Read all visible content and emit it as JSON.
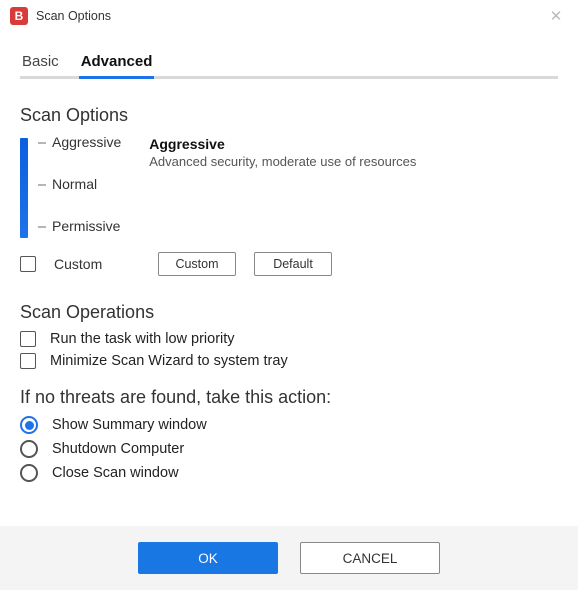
{
  "window": {
    "title": "Scan Options",
    "app_icon_letter": "B"
  },
  "tabs": {
    "basic": "Basic",
    "advanced": "Advanced",
    "active": "advanced"
  },
  "sections": {
    "scan_options_heading": "Scan Options",
    "scan_operations_heading": "Scan Operations",
    "no_threats_heading": "If no threats are found, take this action:"
  },
  "slider": {
    "levels": [
      "Aggressive",
      "Normal",
      "Permissive"
    ],
    "selected": {
      "title": "Aggressive",
      "description": "Advanced security, moderate use of resources"
    }
  },
  "custom": {
    "checkbox_label": "Custom",
    "checked": false,
    "custom_button": "Custom",
    "default_button": "Default"
  },
  "operations": [
    {
      "label": "Run the task with low priority",
      "checked": false
    },
    {
      "label": "Minimize Scan Wizard to system tray",
      "checked": false
    }
  ],
  "no_threats_options": [
    {
      "label": "Show Summary window",
      "selected": true
    },
    {
      "label": "Shutdown Computer",
      "selected": false
    },
    {
      "label": "Close Scan window",
      "selected": false
    }
  ],
  "footer": {
    "ok": "OK",
    "cancel": "CANCEL"
  }
}
